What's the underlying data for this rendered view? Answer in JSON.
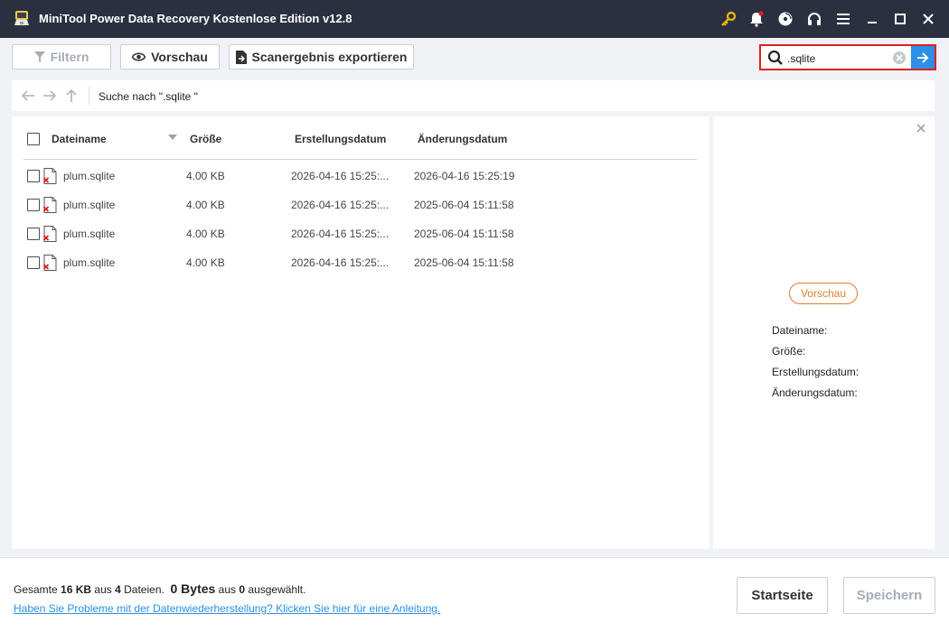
{
  "window": {
    "title": "MiniTool Power Data Recovery Kostenlose Edition v12.8",
    "icons": [
      "key-icon",
      "bell-icon",
      "disc-icon",
      "headphones-icon",
      "menu-icon",
      "minimize-icon",
      "maximize-icon",
      "close-icon"
    ]
  },
  "toolbar": {
    "filter_label": "Filtern",
    "preview_label": "Vorschau",
    "export_label": "Scanergebnis exportieren"
  },
  "search": {
    "value": ".sqlite"
  },
  "nav": {
    "path": "Suche nach \".sqlite \""
  },
  "list": {
    "columns": [
      "Dateiname",
      "Größe",
      "Erstellungsdatum",
      "Änderungsdatum"
    ],
    "rows": [
      {
        "name": "plum.sqlite",
        "size": "4.00 KB",
        "created": "2026-04-16 15:25:...",
        "modified": "2026-04-16 15:25:19"
      },
      {
        "name": "plum.sqlite",
        "size": "4.00 KB",
        "created": "2026-04-16 15:25:...",
        "modified": "2025-06-04 15:11:58"
      },
      {
        "name": "plum.sqlite",
        "size": "4.00 KB",
        "created": "2026-04-16 15:25:...",
        "modified": "2025-06-04 15:11:58"
      },
      {
        "name": "plum.sqlite",
        "size": "4.00 KB",
        "created": "2026-04-16 15:25:...",
        "modified": "2025-06-04 15:11:58"
      }
    ]
  },
  "preview": {
    "button_label": "Vorschau",
    "labels": [
      "Dateiname:",
      "Größe:",
      "Erstellungsdatum:",
      "Änderungsdatum:"
    ]
  },
  "footer": {
    "summary": {
      "prefix": "Gesamte",
      "total_size": "16 KB",
      "mid1": "aus",
      "file_count": "4",
      "mid2": "Dateien.",
      "selected_bytes": "0 Bytes",
      "mid3": "aus",
      "selected_count": "0",
      "suffix": "ausgewählt."
    },
    "help_link": "Haben Sie Probleme mit der Datenwiederherstellung? Klicken Sie hier für eine Anleitung.",
    "home_button": "Startseite",
    "save_button": "Speichern"
  },
  "colors": {
    "titlebar_bg": "#2b3041",
    "accent_blue": "#2d8fe6",
    "search_border": "#e0201f",
    "preview_orange": "#e07a2e",
    "notification_red": "#e0201f"
  }
}
